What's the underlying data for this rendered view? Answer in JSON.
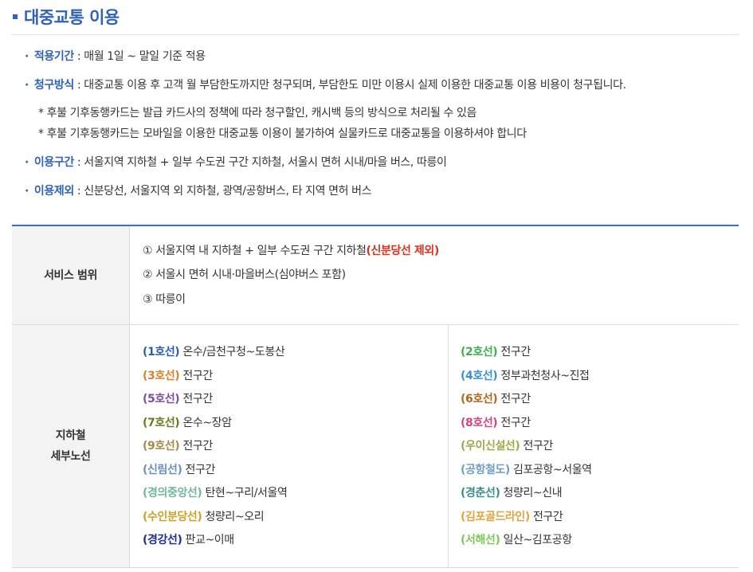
{
  "header": {
    "title": "대중교통 이용"
  },
  "info": {
    "period_term": "적용기간",
    "period_desc": " : 매월 1일 ~ 말일 기준 적용",
    "billing_term": "청구방식",
    "billing_desc": " : 대중교통 이용 후 고객 월 부담한도까지만 청구되며, 부담한도 미만 이용시 실제 이용한 대중교통 이용 비용이 청구됩니다.",
    "note1": "* 후불 기후동행카드는 발급 카드사의 정책에 따라 청구할인, 캐시백 등의 방식으로 처리될 수 있음",
    "note2": "* 후불 기후동행카드는 모바일을 이용한 대중교통 이용이 불가하여 실물카드로 대중교통을 이용하셔야 합니다",
    "range_term": "이용구간",
    "range_desc": " : 서울지역 지하철 + 일부 수도권 구간 지하철, 서울시 면허 시내/마을 버스, 따릉이",
    "excluded_term": "이용제외",
    "excluded_desc": " : 신분당선, 서울지역 외 지하철, 광역/공항버스, 타 지역 면허 버스"
  },
  "table": {
    "service_header": "서비스 범위",
    "service_items": {
      "item1_text": "① 서울지역 내 지하철 + 일부 수도권 구간 지하철",
      "item1_highlight": "(신분당선 제외)",
      "item2": "② 서울시 면허 시내·마을버스(심야버스 포함)",
      "item3": "③ 따릉이"
    },
    "subway_header_line1": "지하철",
    "subway_header_line2": "세부노선",
    "lines_left": [
      {
        "name": "(1호선)",
        "desc": " 온수/금천구청~도봉산",
        "color": "#2d5fa8"
      },
      {
        "name": "(3호선)",
        "desc": " 전구간",
        "color": "#d9822b"
      },
      {
        "name": "(5호선)",
        "desc": " 전구간",
        "color": "#7b4ea3"
      },
      {
        "name": "(7호선)",
        "desc": " 온수~장암",
        "color": "#6b7a20"
      },
      {
        "name": "(9호선)",
        "desc": " 전구간",
        "color": "#a88a4a"
      },
      {
        "name": "(신림선)",
        "desc": " 전구간",
        "color": "#6c8ebf"
      },
      {
        "name": "(경의중앙선)",
        "desc": " 탄현~구리/서울역",
        "color": "#6fb89a"
      },
      {
        "name": "(수인분당선)",
        "desc": " 청량리~오리",
        "color": "#c9a227"
      },
      {
        "name": "(경강선)",
        "desc": " 판교~이매",
        "color": "#1f2f8f"
      }
    ],
    "lines_right": [
      {
        "name": "(2호선)",
        "desc": " 전구간",
        "color": "#3fae4c"
      },
      {
        "name": "(4호선)",
        "desc": " 정부과천청사~진접",
        "color": "#3b8fd4"
      },
      {
        "name": "(6호선)",
        "desc": " 전구간",
        "color": "#b5651d"
      },
      {
        "name": "(8호선)",
        "desc": " 전구간",
        "color": "#d6437f"
      },
      {
        "name": "(우이신설선)",
        "desc": " 전구간",
        "color": "#a0a84a"
      },
      {
        "name": "(공항철도)",
        "desc": " 김포공항~서울역",
        "color": "#6f9fc8"
      },
      {
        "name": "(경춘선)",
        "desc": " 청량리~신내",
        "color": "#3a8f8a"
      },
      {
        "name": "(김포골드라인)",
        "desc": " 전구간",
        "color": "#e0a63c"
      },
      {
        "name": "(서해선)",
        "desc": " 일산~김포공항",
        "color": "#7cc957"
      }
    ]
  }
}
